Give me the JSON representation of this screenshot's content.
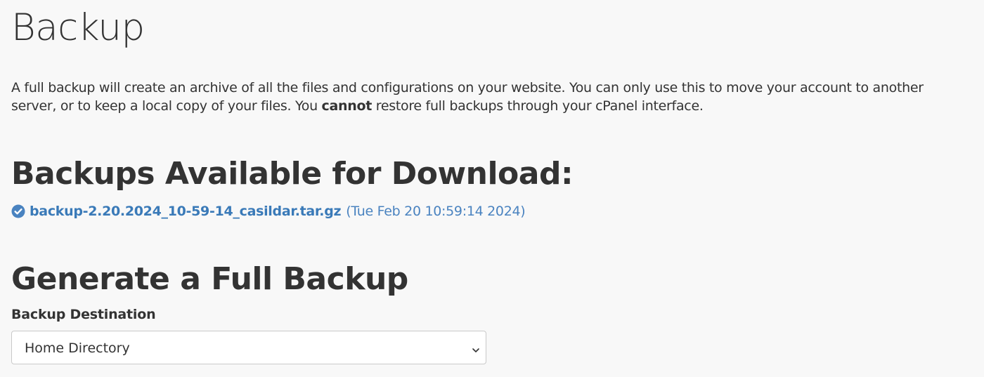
{
  "page": {
    "title": "Backup"
  },
  "intro": {
    "part1": "A full backup will create an archive of all the files and configurations on your website. You can only use this to move your account to another server, or to keep a local copy of your files. You ",
    "emphasis": "cannot",
    "part2": " restore full backups through your cPanel interface."
  },
  "downloads": {
    "heading": "Backups Available for Download:",
    "items": [
      {
        "filename": "backup-2.20.2024_10-59-14_casildar.tar.gz",
        "date": "(Tue Feb 20 10:59:14 2024)",
        "icon": "check-circle-icon"
      }
    ]
  },
  "generate": {
    "heading": "Generate a Full Backup",
    "destination_label": "Backup Destination",
    "destination_value": "Home Directory"
  },
  "colors": {
    "background": "#f8f8f8",
    "text": "#333333",
    "link": "#3a7ab8",
    "check": "#4a83c0",
    "border": "#c9c9c9"
  }
}
